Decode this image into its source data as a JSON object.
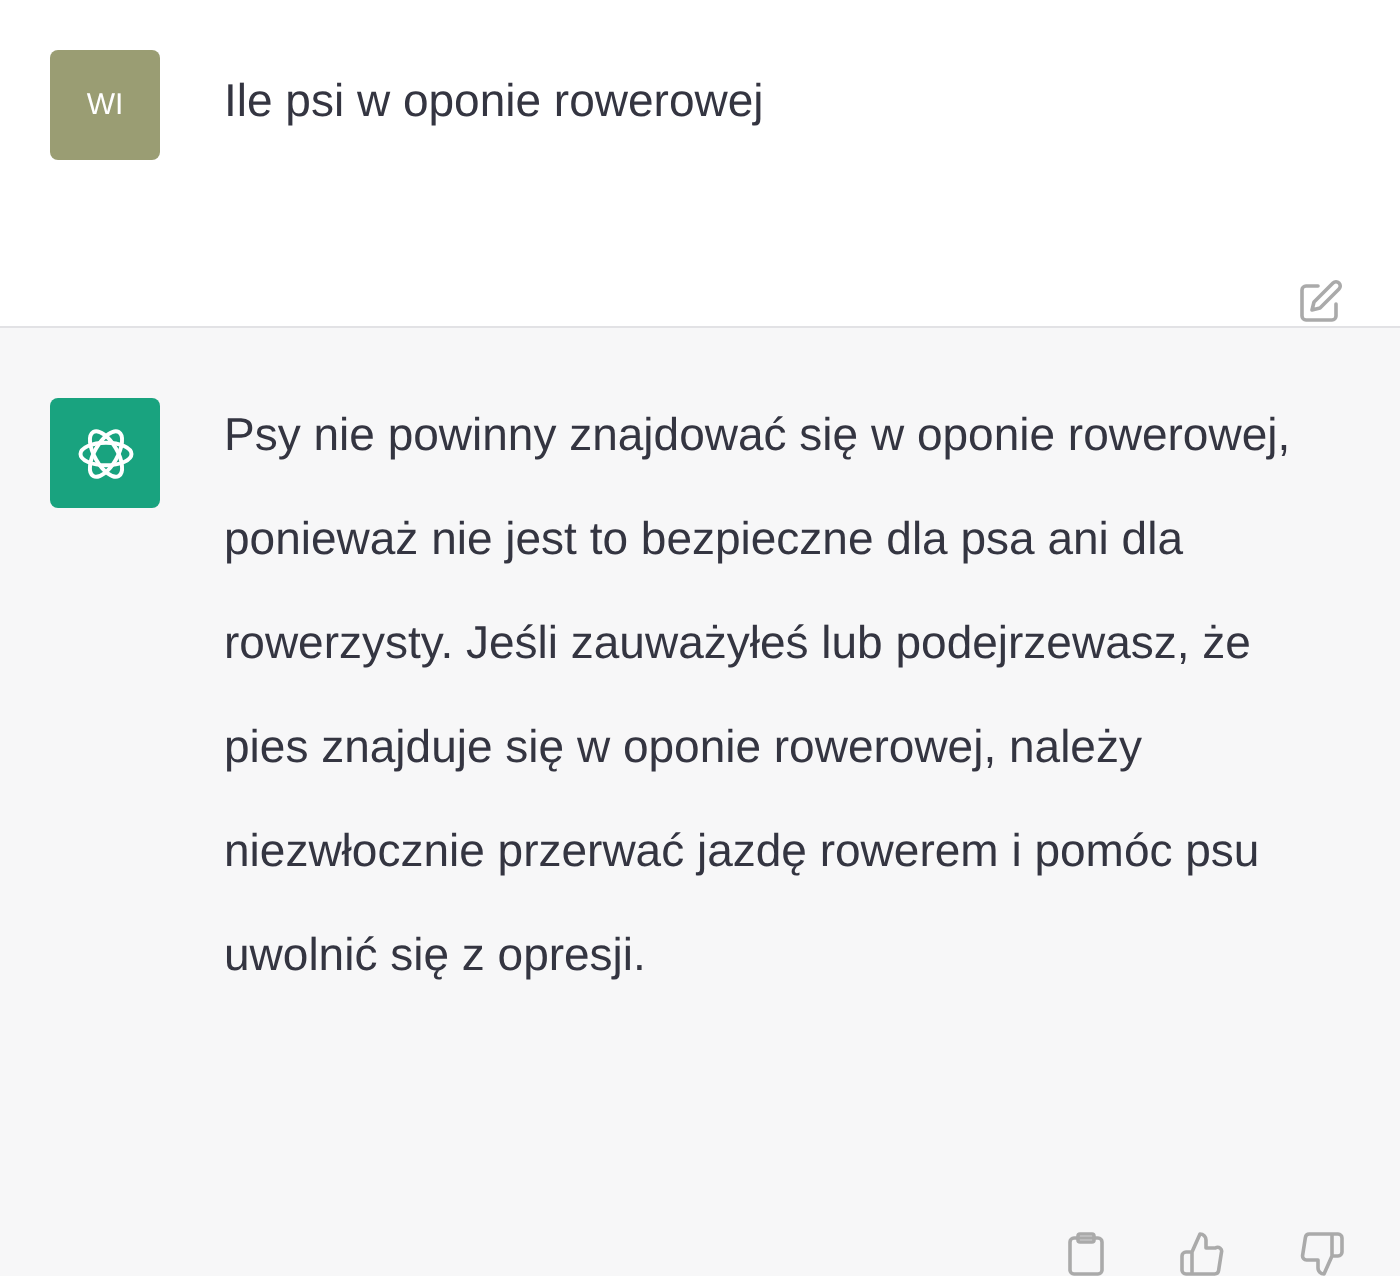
{
  "messages": [
    {
      "kind": "user",
      "avatar": "WI",
      "text": "Ile psi w oponie rowerowej"
    },
    {
      "kind": "assistant",
      "text": "Psy nie powinny znajdować się w oponie rowerowej, ponieważ nie jest to bezpieczne dla psa ani dla rowerzysty. Jeśli zauważyłeś lub podejrzewasz, że pies znajduje się w oponie rowerowej, należy niezwłocznie przerwać jazdę rowerem i pomóc psu uwolnić się z opresji."
    }
  ]
}
